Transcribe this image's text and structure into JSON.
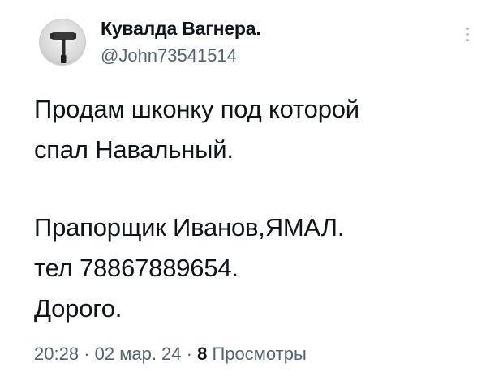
{
  "tweet": {
    "author": {
      "name": "Кувалда Вагнера.",
      "handle": "@John73541514"
    },
    "text": {
      "line1": "Продам шконку под которой",
      "line2": "спал Навальный.",
      "line3": "Прапорщик Иванов,ЯМАЛ.",
      "line4": "тел 78867889654.",
      "line5": "Дорого."
    },
    "meta": {
      "time": "20:28",
      "sep1": "·",
      "date": "02 мар. 24",
      "sep2": "·",
      "views_count": "8",
      "views_label": "Просмотры"
    },
    "icons": {
      "avatar": "sledgehammer-avatar",
      "more": "more-vertical-icon"
    },
    "colors": {
      "text": "#0f1419",
      "secondary": "#536471",
      "background": "#ffffff"
    }
  }
}
